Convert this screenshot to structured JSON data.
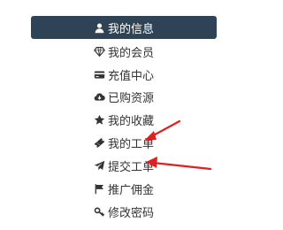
{
  "menu": {
    "active": {
      "label": "我的信息",
      "icon": "user-icon"
    },
    "items": [
      {
        "label": "我的会员",
        "icon": "diamond-icon"
      },
      {
        "label": "充值中心",
        "icon": "credit-card-icon"
      },
      {
        "label": "已购资源",
        "icon": "cloud-download-icon"
      },
      {
        "label": "我的收藏",
        "icon": "star-icon"
      },
      {
        "label": "我的工单",
        "icon": "ticket-icon"
      },
      {
        "label": "提交工单",
        "icon": "paper-plane-icon"
      },
      {
        "label": "推广佣金",
        "icon": "flag-icon"
      },
      {
        "label": "修改密码",
        "icon": "key-icon"
      }
    ]
  },
  "colors": {
    "active_bg": "#2f4356",
    "text": "#333333",
    "arrow": "#e02020"
  }
}
